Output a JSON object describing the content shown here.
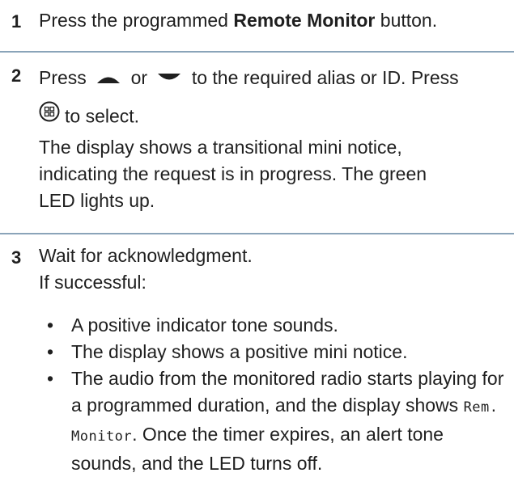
{
  "steps": [
    {
      "number": "1",
      "text_before": "Press the programmed ",
      "bold_text": "Remote Monitor",
      "text_after": " button."
    },
    {
      "number": "2",
      "press_label": "Press",
      "or_label": "or",
      "after_arrows": "to the required alias or ID. Press",
      "select_text": "to select.",
      "description": "The display shows a transitional mini notice, indicating the request is in progress. The green LED lights up."
    },
    {
      "number": "3",
      "line1": "Wait for acknowledgment.",
      "line2": "If successful:",
      "bullets": [
        "A positive indicator tone sounds.",
        "The display shows a positive mini notice."
      ],
      "bullet3_before": "The audio from the monitored radio starts playing for a programmed duration, and the display shows ",
      "bullet3_display": "Rem. Monitor",
      "bullet3_after": ". Once the timer expires, an alert tone sounds, and the LED turns off."
    }
  ],
  "bullet_char": "•",
  "icons": [
    "up-arrow-icon",
    "down-arrow-icon",
    "menu-ok-button-icon"
  ],
  "colors": {
    "text": "#1f1f1f",
    "divider": "#8aa4b9"
  }
}
